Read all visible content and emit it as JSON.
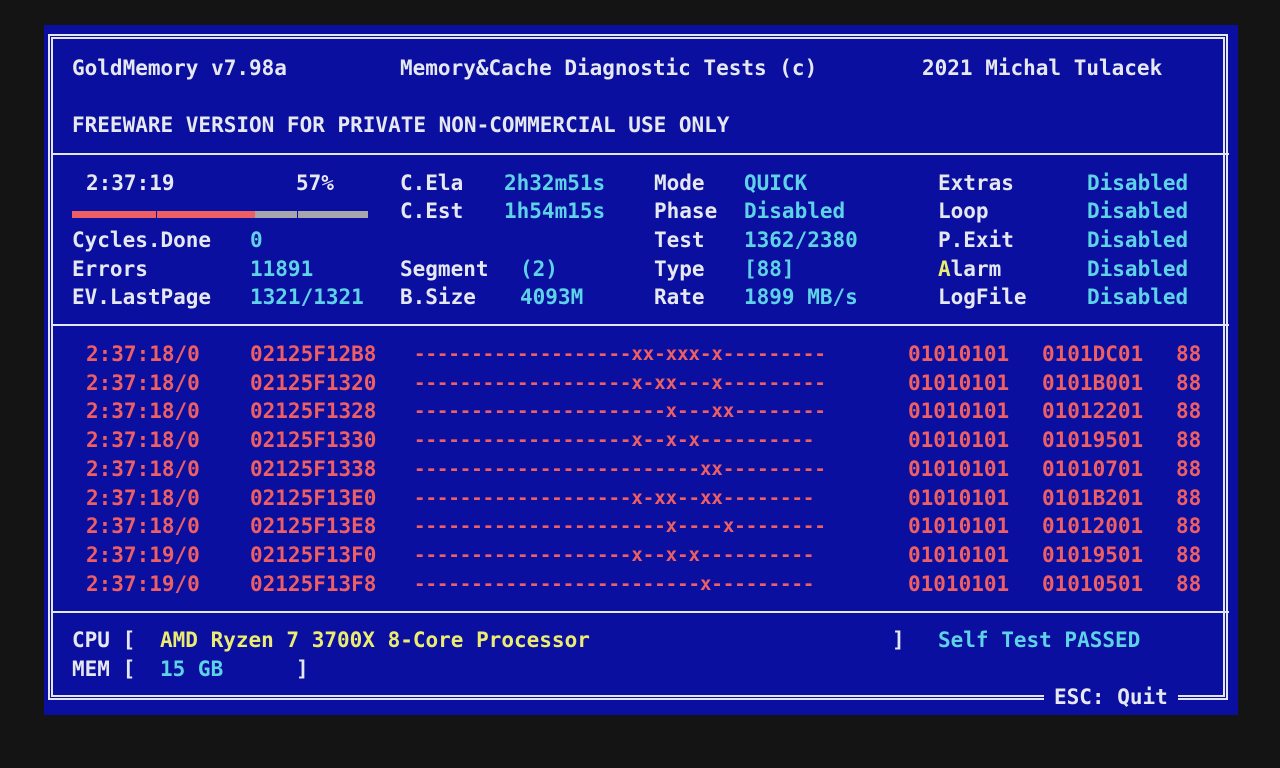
{
  "header": {
    "app": "GoldMemory v7.98a",
    "subtitle": "Memory&Cache Diagnostic Tests (c)",
    "copyright": "2021 Michal Tulacek",
    "license": "FREEWARE VERSION FOR PRIVATE NON-COMMERCIAL USE ONLY"
  },
  "status": {
    "clock": "2:37:19",
    "percent": "57%",
    "progress_fraction": 0.57,
    "progress_segments_total": 21,
    "progress_segments_done": 13,
    "labels": {
      "c_ela": "C.Ela",
      "c_est": "C.Est",
      "cycles": "Cycles.Done",
      "errors": "Errors",
      "ev_lastpage": "EV.LastPage",
      "segment": "Segment",
      "b_size": "B.Size",
      "mode": "Mode",
      "phase": "Phase",
      "test": "Test",
      "type": "Type",
      "rate": "Rate",
      "extras": "Extras",
      "loop": "Loop",
      "p_exit": "P.Exit",
      "alarm_first": "A",
      "alarm_rest": "larm",
      "logfile": "LogFile"
    },
    "values": {
      "c_ela": "2h32m51s",
      "c_est": "1h54m15s",
      "cycles": "0",
      "errors": "11891",
      "ev_lastpage": "1321/1321",
      "segment": "(2)",
      "b_size": "4093M",
      "mode": "QUICK",
      "phase": "Disabled",
      "test": "1362/2380",
      "type": "[88]",
      "rate": "1899 MB/s",
      "extras": "Disabled",
      "loop": "Disabled",
      "p_exit": "Disabled",
      "alarm": "Disabled",
      "logfile": "Disabled"
    }
  },
  "log": [
    {
      "time": "2:37:18/0",
      "addr": "02125F12B8",
      "bits": "-------------------xx-xxx-x---------",
      "p1": "01010101",
      "p2": "0101DC01",
      "t": "88"
    },
    {
      "time": "2:37:18/0",
      "addr": "02125F1320",
      "bits": "-------------------x-xx---x---------",
      "p1": "01010101",
      "p2": "0101B001",
      "t": "88"
    },
    {
      "time": "2:37:18/0",
      "addr": "02125F1328",
      "bits": "----------------------x---xx--------",
      "p1": "01010101",
      "p2": "01012201",
      "t": "88"
    },
    {
      "time": "2:37:18/0",
      "addr": "02125F1330",
      "bits": "-------------------x--x-x----------",
      "p1": "01010101",
      "p2": "01019501",
      "t": "88"
    },
    {
      "time": "2:37:18/0",
      "addr": "02125F1338",
      "bits": "-------------------------xx---------",
      "p1": "01010101",
      "p2": "01010701",
      "t": "88"
    },
    {
      "time": "2:37:18/0",
      "addr": "02125F13E0",
      "bits": "-------------------x-xx--xx--------",
      "p1": "01010101",
      "p2": "0101B201",
      "t": "88"
    },
    {
      "time": "2:37:18/0",
      "addr": "02125F13E8",
      "bits": "----------------------x----x--------",
      "p1": "01010101",
      "p2": "01012001",
      "t": "88"
    },
    {
      "time": "2:37:19/0",
      "addr": "02125F13F0",
      "bits": "-------------------x--x-x----------",
      "p1": "01010101",
      "p2": "01019501",
      "t": "88"
    },
    {
      "time": "2:37:19/0",
      "addr": "02125F13F8",
      "bits": "-------------------------x---------",
      "p1": "01010101",
      "p2": "01010501",
      "t": "88"
    }
  ],
  "footer": {
    "cpu_label": "CPU [",
    "cpu_value": "AMD Ryzen 7 3700X 8-Core Processor",
    "cpu_close": "]",
    "self_test": "Self Test PASSED",
    "mem_label": "MEM [",
    "mem_value": "15 GB",
    "mem_close": "]",
    "esc": "ESC: Quit"
  },
  "colors": {
    "background": "#0b0fa0",
    "text": "#e6e8f0",
    "value": "#5ed3e8",
    "highlight": "#ecec70",
    "error": "#ee5f63"
  }
}
